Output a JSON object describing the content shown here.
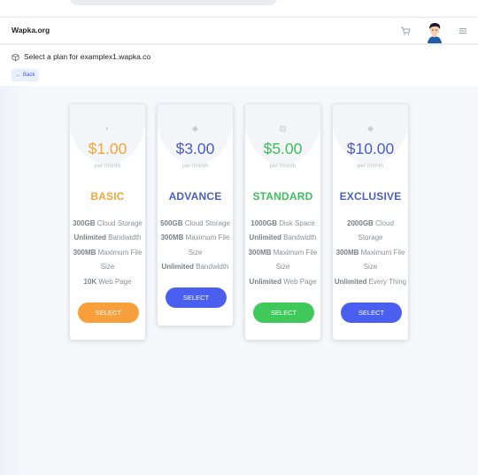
{
  "site": {
    "brand": "Wapka.org"
  },
  "header": {
    "title": "Select a plan for examplex1.wapka.co",
    "back_label": "Back"
  },
  "plans": [
    {
      "price": "$1.00",
      "period": "per month",
      "name": "BASIC",
      "color": "#f4a53b",
      "icon": "half-circle-icon",
      "features": [
        {
          "bold": "300GB",
          "text": " Cloud Storage"
        },
        {
          "bold": "Unlimited",
          "text": " Bandwidth"
        },
        {
          "bold": "300MB",
          "text": " Maximum File Size"
        },
        {
          "bold": "10K",
          "text": " Web Page"
        }
      ],
      "button": "SELECT"
    },
    {
      "price": "$3.00",
      "period": "per month",
      "name": "ADVANCE",
      "color": "#4a5fc1",
      "icon": "diamond-icon",
      "features": [
        {
          "bold": "500GB",
          "text": " Cloud Storage"
        },
        {
          "bold": "300MB",
          "text": " Maximum File Size"
        },
        {
          "bold": "Unlimited",
          "text": " Bandwidth"
        }
      ],
      "button": "SELECT"
    },
    {
      "price": "$5.00",
      "period": "per month",
      "name": "STANDARD",
      "color": "#3fbe5c",
      "icon": "briefcase-icon",
      "features": [
        {
          "bold": "1000GB",
          "text": " Disk Space"
        },
        {
          "bold": "Unlimited",
          "text": " Bandwidth"
        },
        {
          "bold": "300MB",
          "text": " Maximum File Size"
        },
        {
          "bold": "Unlimited",
          "text": " Web Page"
        }
      ],
      "button": "SELECT"
    },
    {
      "price": "$10.00",
      "period": "per month",
      "name": "EXCLUSIVE",
      "color": "#4a5fc1",
      "icon": "diamond-icon",
      "features": [
        {
          "bold": "2000GB",
          "text": " Cloud Storage"
        },
        {
          "bold": "300MB",
          "text": " Maximum File Size"
        },
        {
          "bold": "Unlimited",
          "text": " Every Thing"
        }
      ],
      "button": "SELECT"
    }
  ],
  "button_colors": [
    "#f79f3b",
    "#4a5ef0",
    "#3ec95a",
    "#4a5ef0"
  ]
}
